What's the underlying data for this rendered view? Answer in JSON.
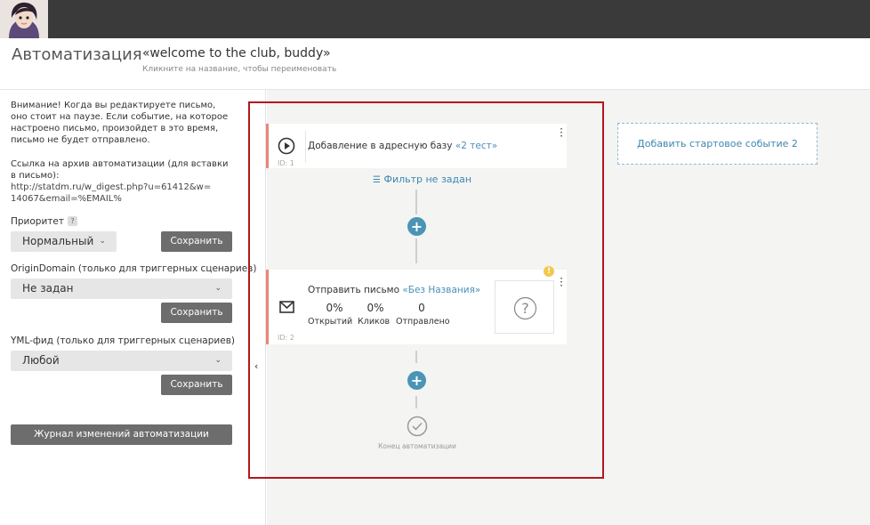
{
  "header": {
    "title": "Автоматизация",
    "name": "«welcome to the club, buddy»",
    "hint": "Кликните на название, чтобы переименовать"
  },
  "sidebar": {
    "warning": "Внимание! Когда вы редактируете письмо, оно стоит на паузе. Если событие, на которое настроено письмо, произойдет в это время, письмо не будет отправлено.",
    "archive_label": "Ссылка на архив автоматизации (для вставки в письмо):",
    "archive_url": "http://statdm.ru/w_digest.php?u=61412&w=14067&email=%EMAIL%",
    "priority_label": "Приоритет",
    "priority_value": "Нормальный",
    "origin_label": "OriginDomain (только для триггерных сценариев)",
    "origin_value": "Не задан",
    "yml_label": "YML-фид (только для триггерных сценариев)",
    "yml_value": "Любой",
    "save_label": "Сохранить",
    "log_button": "Журнал изменений автоматизации"
  },
  "flow": {
    "event_card": {
      "text": "Добавление в адресную базу",
      "link": "«2 тест»",
      "id": "ID: 1"
    },
    "filter": "Фильтр не задан",
    "email_card": {
      "text": "Отправить письмо",
      "link": "«Без Названия»",
      "id": "ID: 2",
      "stats": [
        {
          "value": "0%",
          "label": "Открытий"
        },
        {
          "value": "0%",
          "label": "Кликов"
        },
        {
          "value": "0",
          "label": "Отправлено"
        }
      ]
    },
    "end_label": "Конец автоматизации",
    "add_start_event": "Добавить стартовое событие 2"
  },
  "colors": {
    "accent": "#4a94b6",
    "card_border": "#e8877a",
    "highlight": "#b3171d",
    "warning": "#f2c94c"
  }
}
